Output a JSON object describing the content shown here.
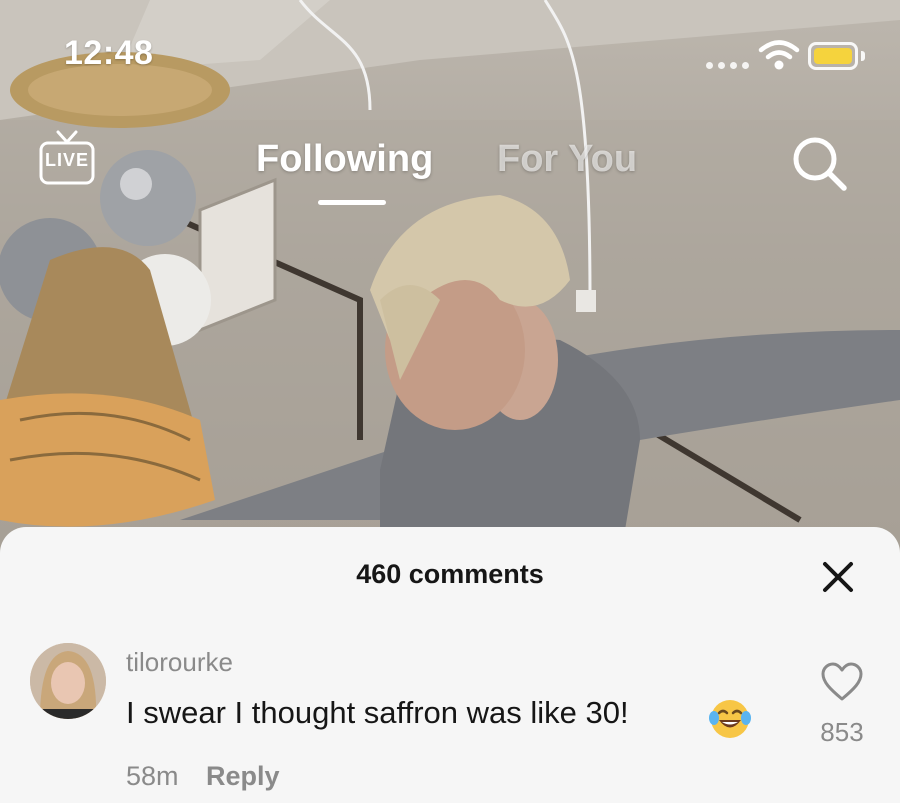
{
  "status_bar": {
    "time": "12:48"
  },
  "top_nav": {
    "live_label": "LIVE",
    "tabs": [
      {
        "label": "Following",
        "active": true
      },
      {
        "label": "For You",
        "active": false
      }
    ]
  },
  "comments_sheet": {
    "title": "460 comments",
    "comments": [
      {
        "username": "tilorourke",
        "text": "I swear I thought saffron was like 30!",
        "emoji": "face-with-tears-of-joy",
        "timestamp": "58m",
        "reply_label": "Reply",
        "like_count": "853"
      }
    ]
  },
  "colors": {
    "battery": "#f5d33d",
    "sheet_background": "#f6f6f6",
    "muted_text": "#8a8a8a"
  }
}
